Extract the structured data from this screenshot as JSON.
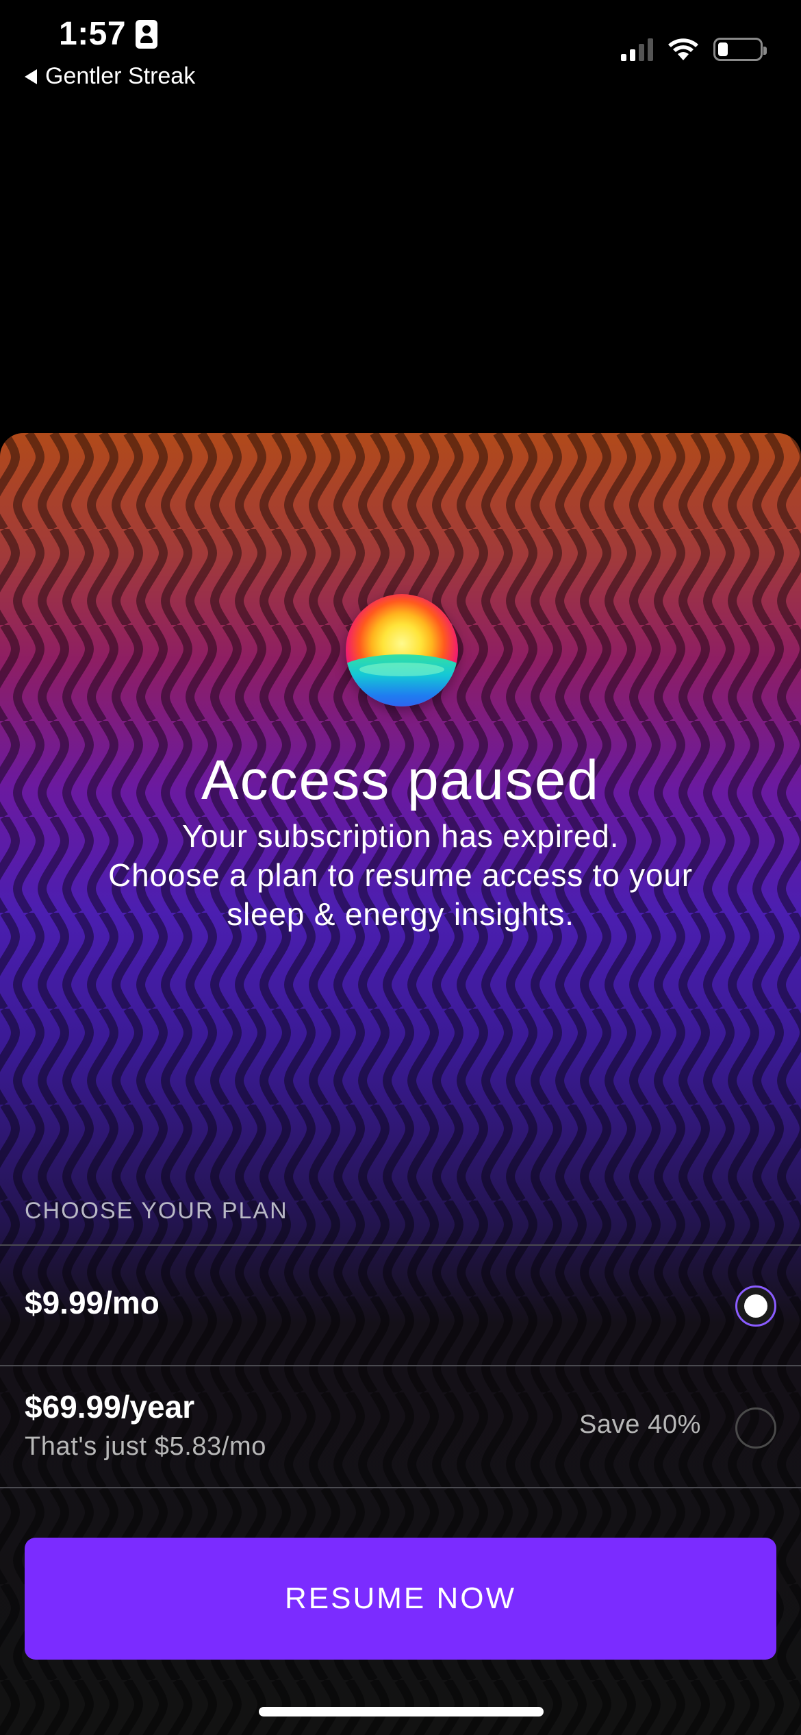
{
  "status_bar": {
    "time": "1:57",
    "back_app": "Gentler Streak"
  },
  "paywall": {
    "title": "Access paused",
    "subtitle_lines": [
      "Your subscription has expired.",
      "Choose a plan to resume access to your",
      "sleep & energy insights."
    ],
    "plan_heading": "CHOOSE YOUR PLAN",
    "plans": [
      {
        "price": "$9.99/mo",
        "note": "",
        "save": "",
        "selected": true
      },
      {
        "price": "$69.99/year",
        "note": "That's just $5.83/mo",
        "save": "Save 40%",
        "selected": false
      }
    ],
    "cta_label": "RESUME NOW"
  },
  "colors": {
    "accent": "#7b2cff",
    "radio_ring": "#8a5cff",
    "background": "#000000"
  },
  "icons": [
    "id-card-icon",
    "back-arrow-icon",
    "signal-icon",
    "wifi-icon",
    "battery-icon",
    "app-logo-icon"
  ]
}
